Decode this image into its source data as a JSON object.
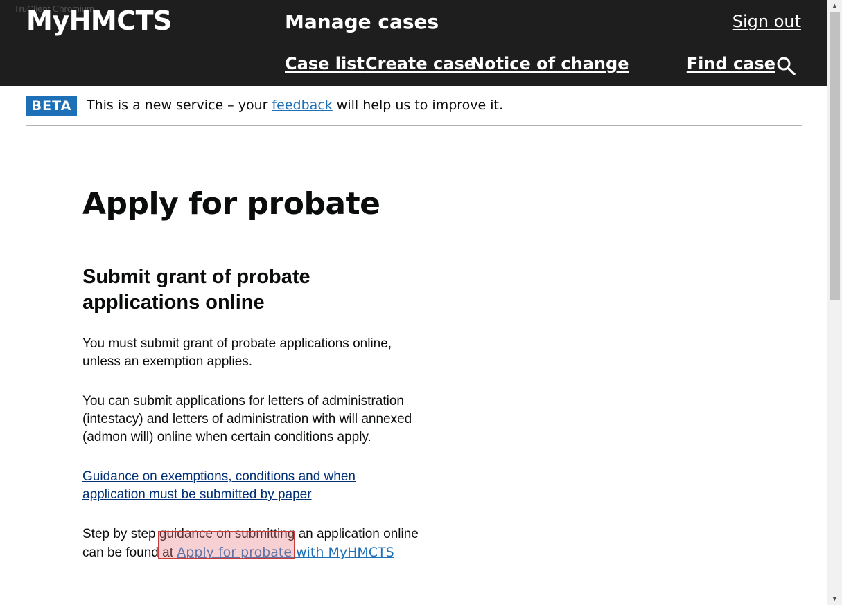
{
  "browser": {
    "ghost_title": "TruClient Chromium"
  },
  "header": {
    "logo": "MyHMCTS",
    "service_name": "Manage cases",
    "sign_out": "Sign out",
    "nav": {
      "case_list": "Case list",
      "create_case": "Create case",
      "notice_of_change": "Notice of change",
      "find_case": "Find case"
    }
  },
  "beta_banner": {
    "tag": "BETA",
    "text_before": "This is a new service – your ",
    "link": "feedback",
    "text_after": " will help us to improve it."
  },
  "main": {
    "title": "Apply for probate",
    "section_heading": "Submit grant of probate applications online",
    "para1": "You must submit grant of probate applications online, unless an exemption applies.",
    "para2": "You can submit applications for letters of administration (intestacy) and letters of administration with will annexed (admon will) online when certain conditions apply.",
    "guidance_link": "Guidance on exemptions, conditions and when application must be submitted by paper",
    "para3_text": "Step by step guidance on submitting an application online can be found at ",
    "para3_link": "Apply for probate with MyHMCTS"
  },
  "colors": {
    "header_bg": "#1e1e1e",
    "beta_tag": "#1d70b8",
    "link": "#1d70b8",
    "visited_link": "#003078",
    "highlight": "#c93a3a"
  },
  "icons": {
    "search": "search-icon",
    "scroll_up": "scroll-up-arrow-icon",
    "scroll_down": "scroll-down-arrow-icon"
  }
}
